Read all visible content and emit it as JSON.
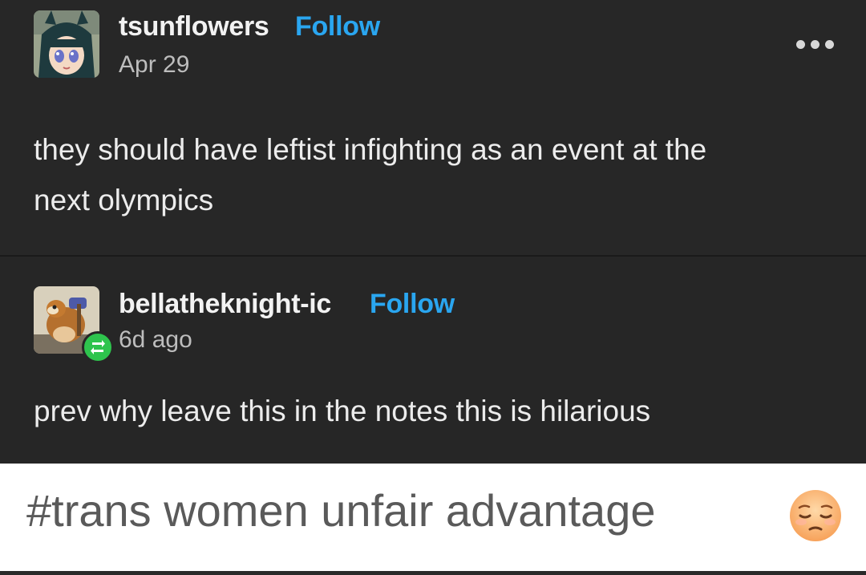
{
  "posts": [
    {
      "username": "tsunflowers",
      "follow_label": "Follow",
      "timestamp": "Apr 29",
      "body": [
        "they should have leftist infighting as an event at the",
        "next olympics"
      ],
      "menu_icon": "more-horizontal-icon"
    },
    {
      "username": "bellatheknight-ic",
      "follow_label": "Follow",
      "timestamp": "6d ago",
      "body": [
        "prev why leave this in the notes this is hilarious"
      ],
      "badge_icon": "reblog-icon"
    }
  ],
  "tag": {
    "text": "#trans women unfair advantage",
    "emoji_icon": "pensive-face-emoji"
  },
  "colors": {
    "background": "#272727",
    "follow": "#2aa6f0",
    "reblog_badge": "#2ec44d",
    "tag_background": "#ffffff"
  }
}
